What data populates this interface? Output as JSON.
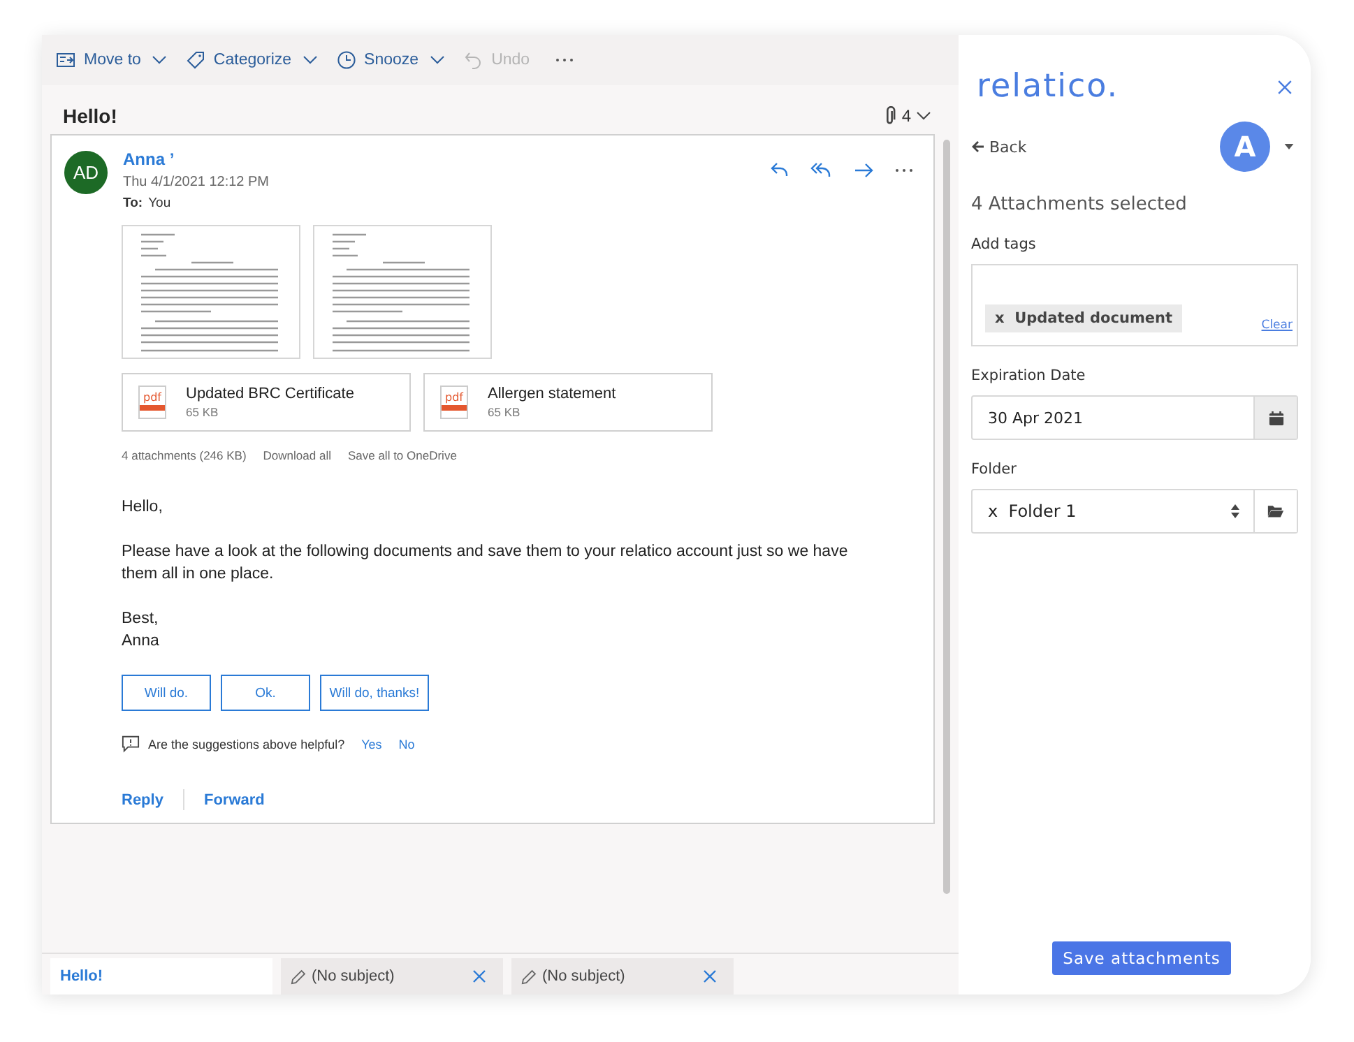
{
  "toolbar": [
    {
      "label": "Move to",
      "disabled": false
    },
    {
      "label": "Categorize",
      "disabled": false
    },
    {
      "label": "Snooze",
      "disabled": false
    },
    {
      "label": "Undo",
      "disabled": true
    }
  ],
  "subject": "Hello!",
  "attachment_count": "4",
  "message": {
    "sender": "Anna ʼ",
    "initials": "AD",
    "date": "Thu 4/1/2021 12:12 PM",
    "to_label": "To:",
    "to": "You",
    "attachments": [
      {
        "kind": "preview"
      },
      {
        "kind": "preview"
      },
      {
        "kind": "file",
        "type": "pdf",
        "name": "Updated BRC Certificate",
        "size": "65 KB"
      },
      {
        "kind": "file",
        "type": "pdf",
        "name": "Allergen statement",
        "size": "65 KB"
      }
    ],
    "attachments_summary": "4 attachments (246 KB)",
    "download_all": "Download all",
    "save_all": "Save all to OneDrive",
    "body": [
      [
        "Hello,"
      ],
      [
        "Please have a look at the following documents and save them to your relatico account just so we have them all in one place."
      ],
      [
        "Best,",
        "Anna"
      ]
    ],
    "suggestions": [
      "Will do.",
      "Ok.",
      "Will do, thanks!"
    ],
    "feedback": {
      "question": "Are the suggestions above helpful?",
      "yes": "Yes",
      "no": "No"
    },
    "actions": [
      "Reply",
      "Forward"
    ]
  },
  "compose_tabs": [
    {
      "kind": "message",
      "label": "Hello!",
      "selected": true
    },
    {
      "kind": "draft",
      "label": "(No subject)",
      "selected": false
    },
    {
      "kind": "draft",
      "label": "(No subject)",
      "selected": false
    }
  ],
  "panel": {
    "logo": "relatico.",
    "back": "Back",
    "avatar": "A",
    "heading": "4 Attachments selected",
    "tags_label": "Add tags",
    "tags": [
      {
        "remove": "x",
        "label": "Updated document"
      }
    ],
    "clear": "Clear",
    "expiration_label": "Expiration Date",
    "expiration_value": "30 Apr 2021",
    "folder_label": "Folder",
    "folder_remove": "x",
    "folder_value": "Folder 1",
    "save_button": "Save attachments"
  }
}
